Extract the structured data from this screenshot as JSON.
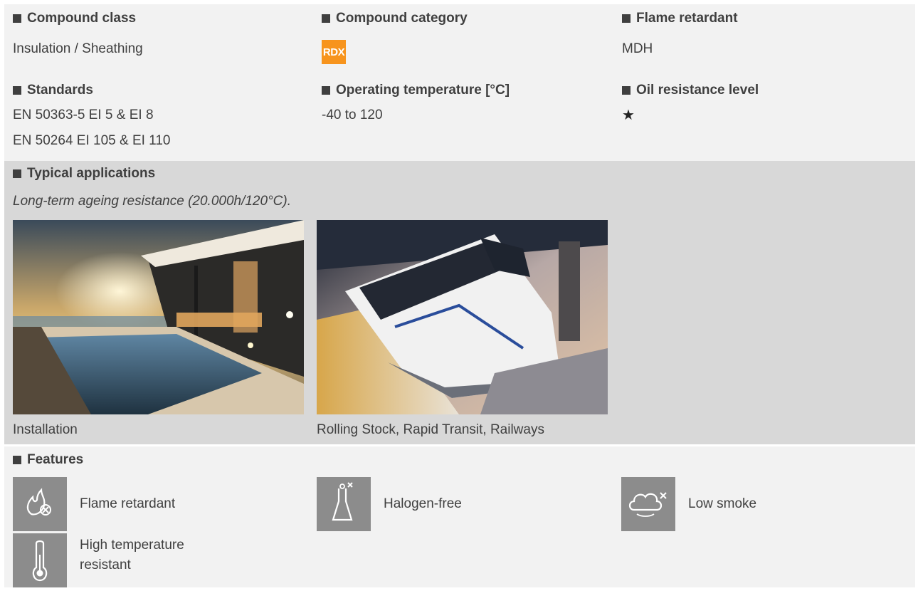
{
  "props": {
    "compound_class": {
      "label": "Compound class",
      "value": "Insulation / Sheathing"
    },
    "compound_category": {
      "label": "Compound category",
      "badge": "RDX",
      "badge_color": "#f7941d"
    },
    "flame_retardant": {
      "label": "Flame retardant",
      "value": "MDH"
    },
    "standards": {
      "label": "Standards",
      "values": [
        "EN 50363-5 EI 5 & EI 8",
        "EN 50264 EI 105 & EI 110"
      ]
    },
    "operating_temperature": {
      "label": "Operating temperature [°C]",
      "value": "-40 to 120"
    },
    "oil_resistance": {
      "label": "Oil resistance level",
      "value": "★"
    }
  },
  "applications": {
    "label": "Typical applications",
    "note": "Long-term ageing resistance (20.000h/120°C).",
    "items": [
      {
        "caption": "Installation",
        "image": "luxury-pool-house-sunset-photo"
      },
      {
        "caption": "Rolling Stock, Rapid Transit, Railways",
        "image": "high-speed-train-photo"
      }
    ]
  },
  "features": {
    "label": "Features",
    "items": [
      {
        "label": "Flame retardant",
        "icon": "flame-x-icon"
      },
      {
        "label": "Halogen-free",
        "icon": "flask-x-icon"
      },
      {
        "label": "Low smoke",
        "icon": "cloud-x-icon"
      },
      {
        "label": "High temperature resistant",
        "icon": "thermometer-icon"
      }
    ]
  },
  "colors": {
    "panel_light": "#f2f2f2",
    "panel_dark": "#d8d8d8",
    "icon_bg": "#8c8c8c",
    "text": "#3f3f3f"
  }
}
